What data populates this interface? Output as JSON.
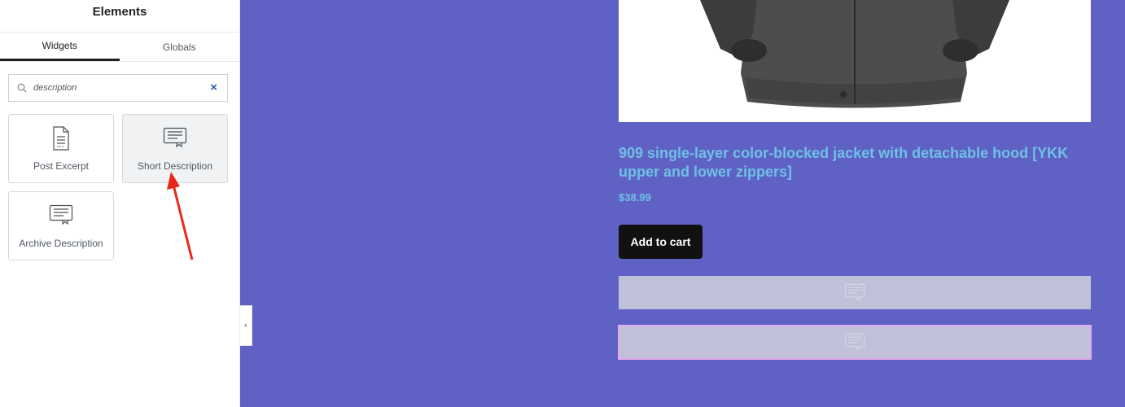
{
  "panel": {
    "title": "Elements",
    "tabs": [
      {
        "label": "Widgets",
        "active": true
      },
      {
        "label": "Globals",
        "active": false
      }
    ],
    "search": {
      "value": "description",
      "icon": "search-icon",
      "clear_icon": "close-icon",
      "clear_label": "×"
    },
    "widgets": [
      {
        "label": "Post Excerpt",
        "icon": "post-excerpt-icon"
      },
      {
        "label": "Short Description",
        "icon": "short-description-icon"
      },
      {
        "label": "Archive Description",
        "icon": "archive-description-icon"
      }
    ],
    "collapse_label": "‹"
  },
  "product": {
    "title": "909 single-layer color-blocked jacket with detachable hood [YKK upper and lower zippers]",
    "price": "$38.99",
    "add_to_cart_label": "Add to cart"
  },
  "colors": {
    "canvas_bg": "#5f61c4",
    "link": "#6ec1e4",
    "button_bg": "#111111",
    "placeholder_bg": "#c0c1d9",
    "selected_outline": "#e6a9ee",
    "annotation_arrow": "#e8281d"
  }
}
